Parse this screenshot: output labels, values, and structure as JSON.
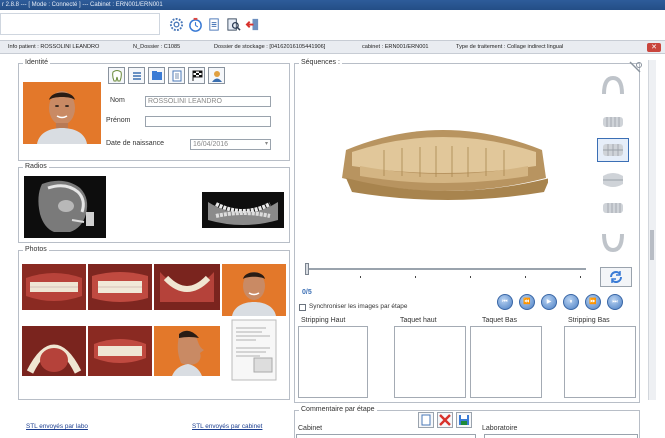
{
  "window": {
    "title": "r 2.8.8 --- [ Mode : Connecté ] ---   Cabinet : ERN001/ERN001"
  },
  "infobar": {
    "patient": "Info patient : ROSSOLINI LEANDRO",
    "dossier": "N_Dossier : C1085",
    "stockage": "Dossier de stockage : [04162016105441906]",
    "cabinet": "cabinet : ERN001/ERN001",
    "traitement": "Type de traitement : Collage indirect lingual"
  },
  "identite": {
    "legend": "Identité",
    "nom_label": "Nom",
    "nom_value": "ROSSOLINI LEANDRO",
    "prenom_label": "Prénom",
    "prenom_value": "",
    "naissance_label": "Date de naissance",
    "naissance_value": "16/04/2016"
  },
  "radios": {
    "legend": "Radios"
  },
  "photos": {
    "legend": "Photos"
  },
  "links": {
    "stl_labo": "STL envoyés par labo",
    "stl_cabinet": "STL envoyés par cabinet"
  },
  "sequences": {
    "legend": "Séquences :",
    "counter": "0/5",
    "sync_label": "Synchroniser les images par étape",
    "strip_labels": [
      "Stripping Haut",
      "Taquet haut",
      "Taquet Bas",
      "Stripping Bas"
    ]
  },
  "commentaire": {
    "legend": "Commentaire par étape",
    "cabinet_label": "Cabinet",
    "labo_label": "Laboratoire"
  },
  "colors": {
    "accent": "#3b6fb5",
    "titlebar": "#2e5c9a",
    "skin": "#c98a64",
    "model": "#c9a46f"
  }
}
